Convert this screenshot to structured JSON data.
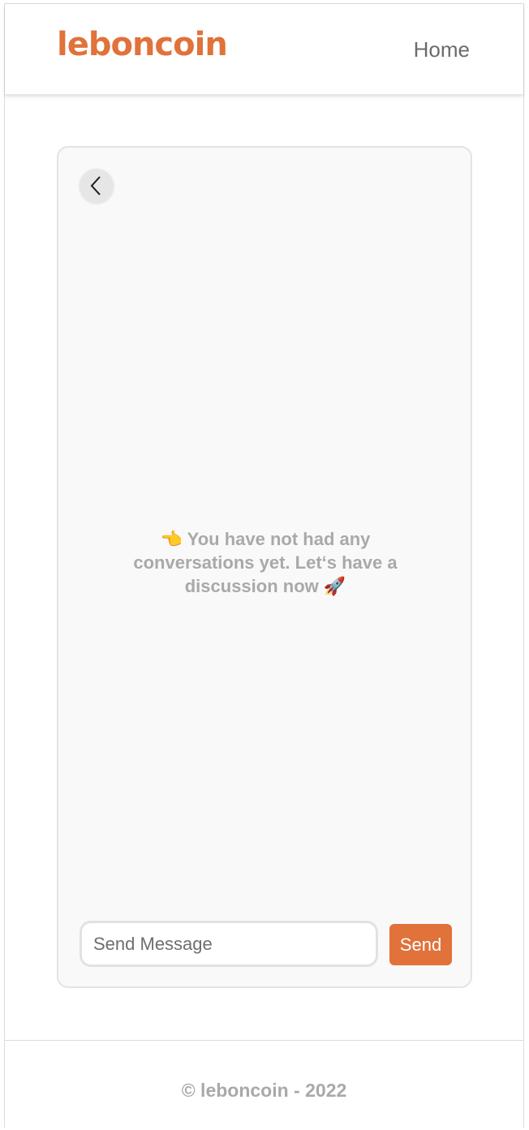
{
  "header": {
    "logo_text": "leboncoin",
    "nav_home_label": "Home"
  },
  "chat": {
    "back_icon": "chevron-left-icon",
    "empty_message": "👈 You have not had any conversations yet. Let‘s have a discussion now 🚀",
    "input_placeholder": "Send Message",
    "input_value": "",
    "send_label": "Send"
  },
  "footer": {
    "copyright": "© leboncoin - 2022"
  },
  "colors": {
    "brand": "#e0723a",
    "muted_text": "#a9a9a9",
    "card_bg": "#f9f9f9"
  }
}
